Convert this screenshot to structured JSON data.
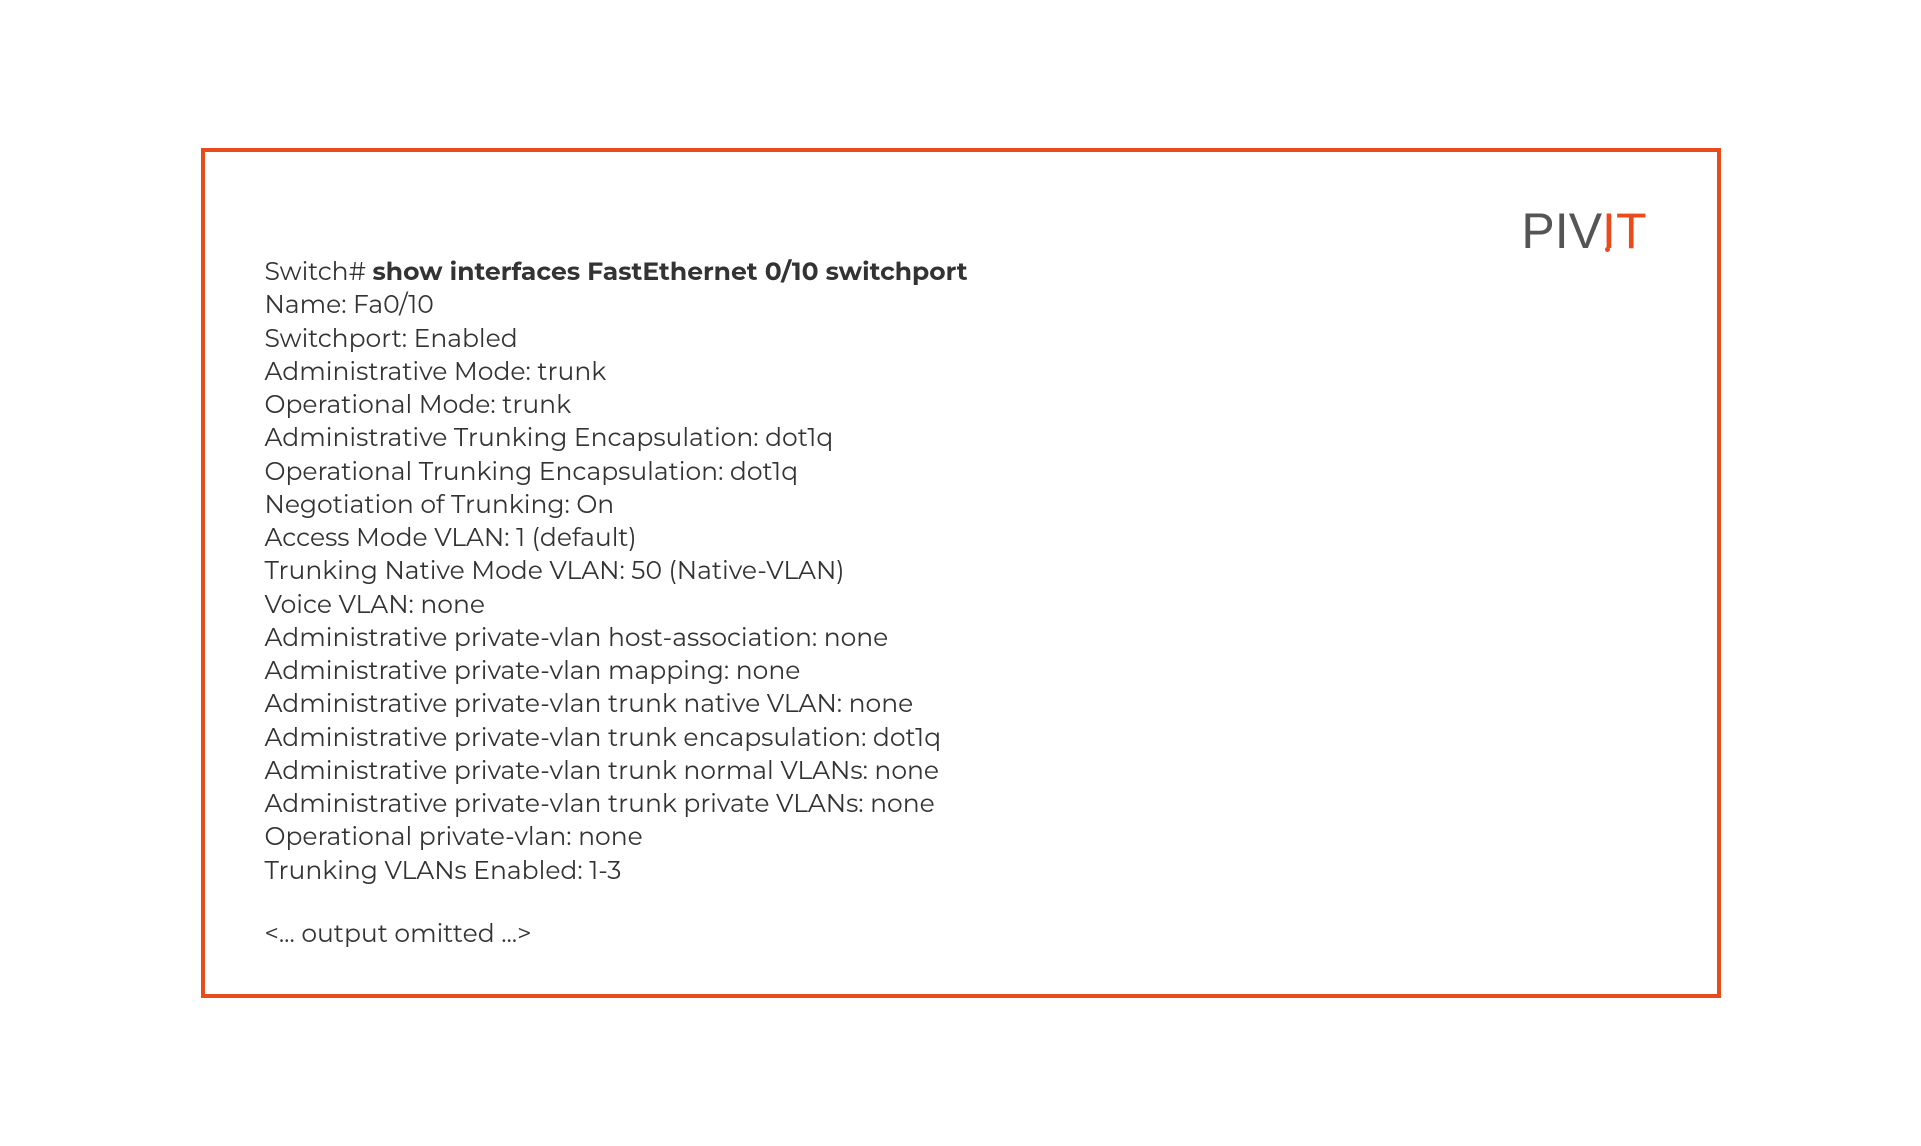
{
  "logo": {
    "text_p": "P",
    "text_i1": "I",
    "text_v": "V",
    "text_i2": "I",
    "text_t": "T"
  },
  "terminal": {
    "prompt": "Switch# ",
    "command": "show interfaces FastEthernet 0/10 switchport",
    "lines": [
      "Name: Fa0/10",
      "Switchport: Enabled",
      "Administrative Mode: trunk",
      "Operational Mode: trunk",
      "Administrative Trunking Encapsulation: dot1q",
      "Operational Trunking Encapsulation: dot1q",
      "Negotiation of Trunking: On",
      "Access Mode VLAN: 1 (default)",
      "Trunking Native Mode VLAN: 50 (Native-VLAN)",
      "Voice VLAN: none",
      "Administrative private-vlan host-association: none",
      "Administrative private-vlan mapping: none",
      "Administrative private-vlan trunk native VLAN: none",
      "Administrative private-vlan trunk encapsulation: dot1q",
      "Administrative private-vlan trunk normal VLANs: none",
      "Administrative private-vlan trunk private VLANs: none",
      "Operational private-vlan: none",
      "Trunking VLANs Enabled: 1-3"
    ],
    "omitted": "<... output omitted ...>"
  }
}
